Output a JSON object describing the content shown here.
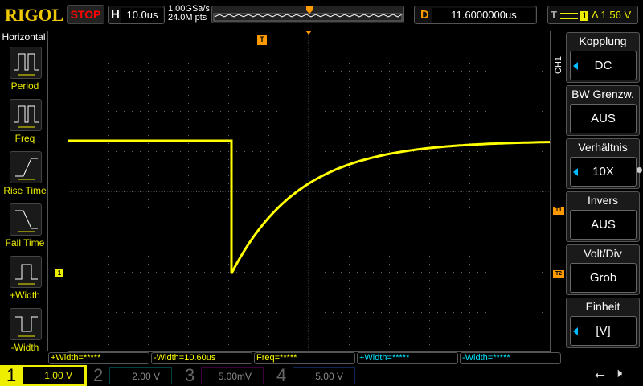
{
  "header": {
    "logo": "RIGOL",
    "run_state": "STOP",
    "h_label": "H",
    "timebase": "10.0us",
    "sample_rate": "1.00GSa/s",
    "mem_depth": "24.0M pts",
    "d_label": "D",
    "delay": "11.6000000us",
    "t_label": "T",
    "trigger_source": "1",
    "trigger_level": "Δ 1.56 V"
  },
  "left_menu": {
    "title": "Horizontal",
    "items": [
      {
        "label": "Period"
      },
      {
        "label": "Freq"
      },
      {
        "label": "Rise Time"
      },
      {
        "label": "Fall Time"
      },
      {
        "label": "+Width"
      },
      {
        "label": "-Width"
      }
    ]
  },
  "right_menu": {
    "channel": "CH1",
    "items": [
      {
        "title": "Kopplung",
        "value": "DC"
      },
      {
        "title": "BW Grenzw.",
        "value": "AUS"
      },
      {
        "title": "Verhältnis",
        "value": "10X"
      },
      {
        "title": "Invers",
        "value": "AUS"
      },
      {
        "title": "Volt/Div",
        "value": "Grob"
      },
      {
        "title": "Einheit",
        "value": "[V]"
      }
    ]
  },
  "markers": {
    "trigger": "T",
    "ch1": "1",
    "t1": "T1",
    "t2": "T2"
  },
  "measurements": [
    {
      "text": "+Width=*****",
      "color": "#ffff00"
    },
    {
      "text": "-Width=10.60us",
      "color": "#ffff00"
    },
    {
      "text": "Freq=*****",
      "color": "#ffff00"
    },
    {
      "text": "+Width=*****",
      "color": "#00e5ff"
    },
    {
      "text": "-Width=*****",
      "color": "#00e5ff"
    }
  ],
  "channels": [
    {
      "num": "1",
      "scale": "1.00 V",
      "color": "#ffff00"
    },
    {
      "num": "2",
      "scale": "2.00 V",
      "color": "#00c0c0"
    },
    {
      "num": "3",
      "scale": "5.00mV",
      "color": "#c000c0"
    },
    {
      "num": "4",
      "scale": "5.00 V",
      "color": "#3070ff"
    }
  ],
  "colors": {
    "trace": "#ffff00",
    "accent": "#ff9900"
  }
}
